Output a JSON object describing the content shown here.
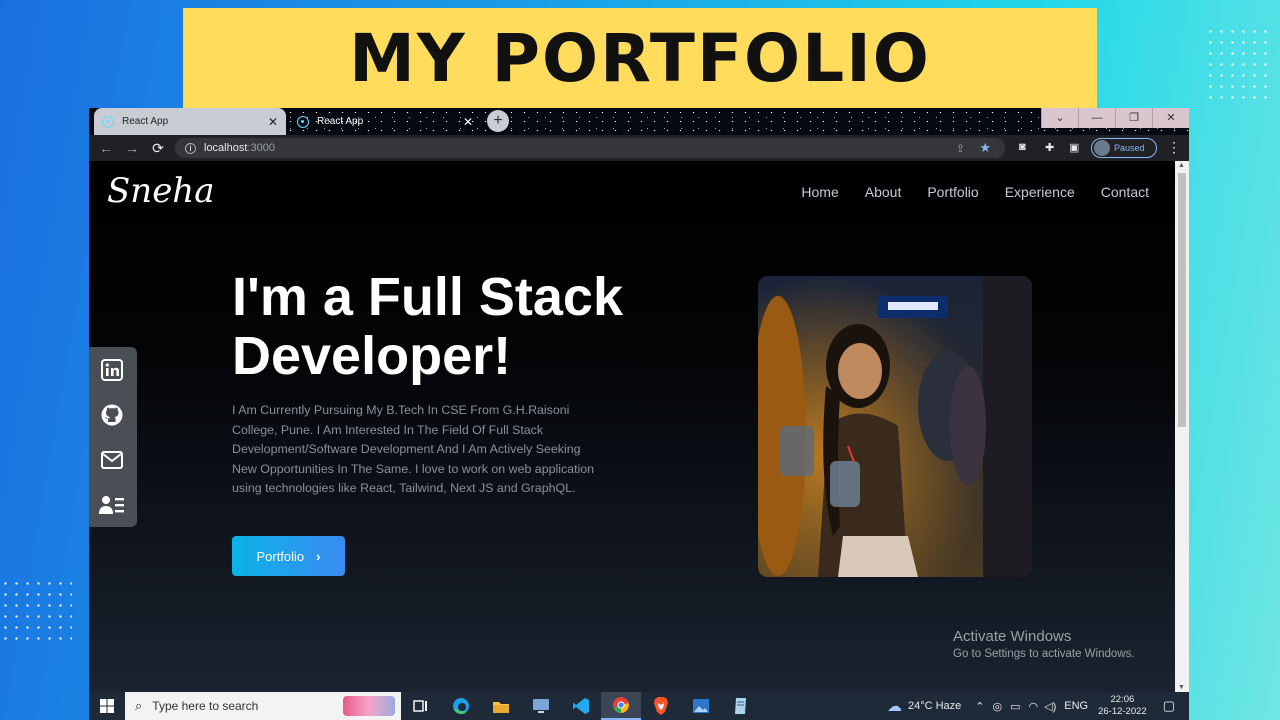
{
  "banner": {
    "title": "MY PORTFOLIO"
  },
  "browser": {
    "tabs": [
      {
        "label": "React App",
        "close": "✕"
      },
      {
        "label": "React App",
        "close": "✕"
      }
    ],
    "new_tab": "+",
    "window_controls": [
      "⌄",
      "—",
      "❐",
      "✕"
    ],
    "nav": {
      "back": "←",
      "forward": "→",
      "reload": "⟳"
    },
    "omnibox": {
      "info": "i",
      "host": "localhost",
      "port": ":3000"
    },
    "profile_status": "Paused",
    "menu": "⋮"
  },
  "site": {
    "logo": "Sneha",
    "nav": [
      "Home",
      "About",
      "Portfolio",
      "Experience",
      "Contact"
    ],
    "hero": {
      "title": "I'm a Full Stack Developer!",
      "description": "I Am Currently Pursuing My B.Tech In CSE From G.H.Raisoni College, Pune. I Am Interested In The Field Of Full Stack Development/Software Development And I Am Actively Seeking New Opportunities In The Same. I love to work on web application using technologies like React, Tailwind, Next JS and GraphQL.",
      "cta_label": "Portfolio",
      "cta_icon": "›"
    },
    "social_links": [
      {
        "icon": "linkedin-icon"
      },
      {
        "icon": "github-icon"
      },
      {
        "icon": "mail-icon"
      },
      {
        "icon": "resume-icon"
      }
    ]
  },
  "activation": {
    "title": "Activate Windows",
    "subtitle": "Go to Settings to activate Windows."
  },
  "taskbar": {
    "search_placeholder": "Type here to search",
    "weather": "24°C  Haze",
    "language": "ENG",
    "time": "22:06",
    "date": "26-12-2022"
  },
  "colors": {
    "banner": "#ffdc5c",
    "cta_start": "#0ab3e8",
    "cta_end": "#3a8cf0",
    "page_bg": "#000000"
  }
}
